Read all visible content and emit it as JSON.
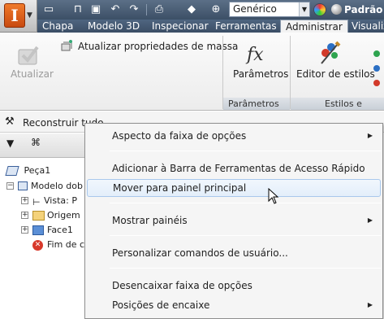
{
  "qat": {
    "style_combo_value": "Genérico",
    "appearance_label": "Padrão"
  },
  "tabs": [
    "Chapa",
    "Modelo 3D",
    "Inspecionar",
    "Ferramentas",
    "Administrar",
    "Visualiz"
  ],
  "ribbon": {
    "update_button": "Atualizar",
    "update_mass_props": "Atualizar propriedades de massa",
    "parameters_button": "Parâmetros",
    "parameters_icon_glyph": "fx",
    "style_editor_button": "Editor de estilos",
    "panel_parameters_footer": "Parâmetros",
    "panel_styles_footer": "Estilos e padrõ"
  },
  "rebuild_all": "Reconstruir tudo",
  "browser": {
    "items": [
      {
        "label": "Peça1"
      },
      {
        "label": "Modelo dob"
      },
      {
        "label": "Vista: P"
      },
      {
        "label": "Origem"
      },
      {
        "label": "Face1"
      },
      {
        "label": "Fim de c"
      }
    ]
  },
  "context_menu": {
    "items": [
      {
        "label": "Aspecto da faixa de opções"
      },
      {
        "label": "Adicionar à Barra de Ferramentas de Acesso Rápido"
      },
      {
        "label": "Mover para painel principal"
      },
      {
        "label": "Mostrar painéis"
      },
      {
        "label": "Personalizar comandos de usuário..."
      },
      {
        "label": "Desencaixar faixa de opções"
      },
      {
        "label": "Posições de encaixe"
      }
    ]
  }
}
